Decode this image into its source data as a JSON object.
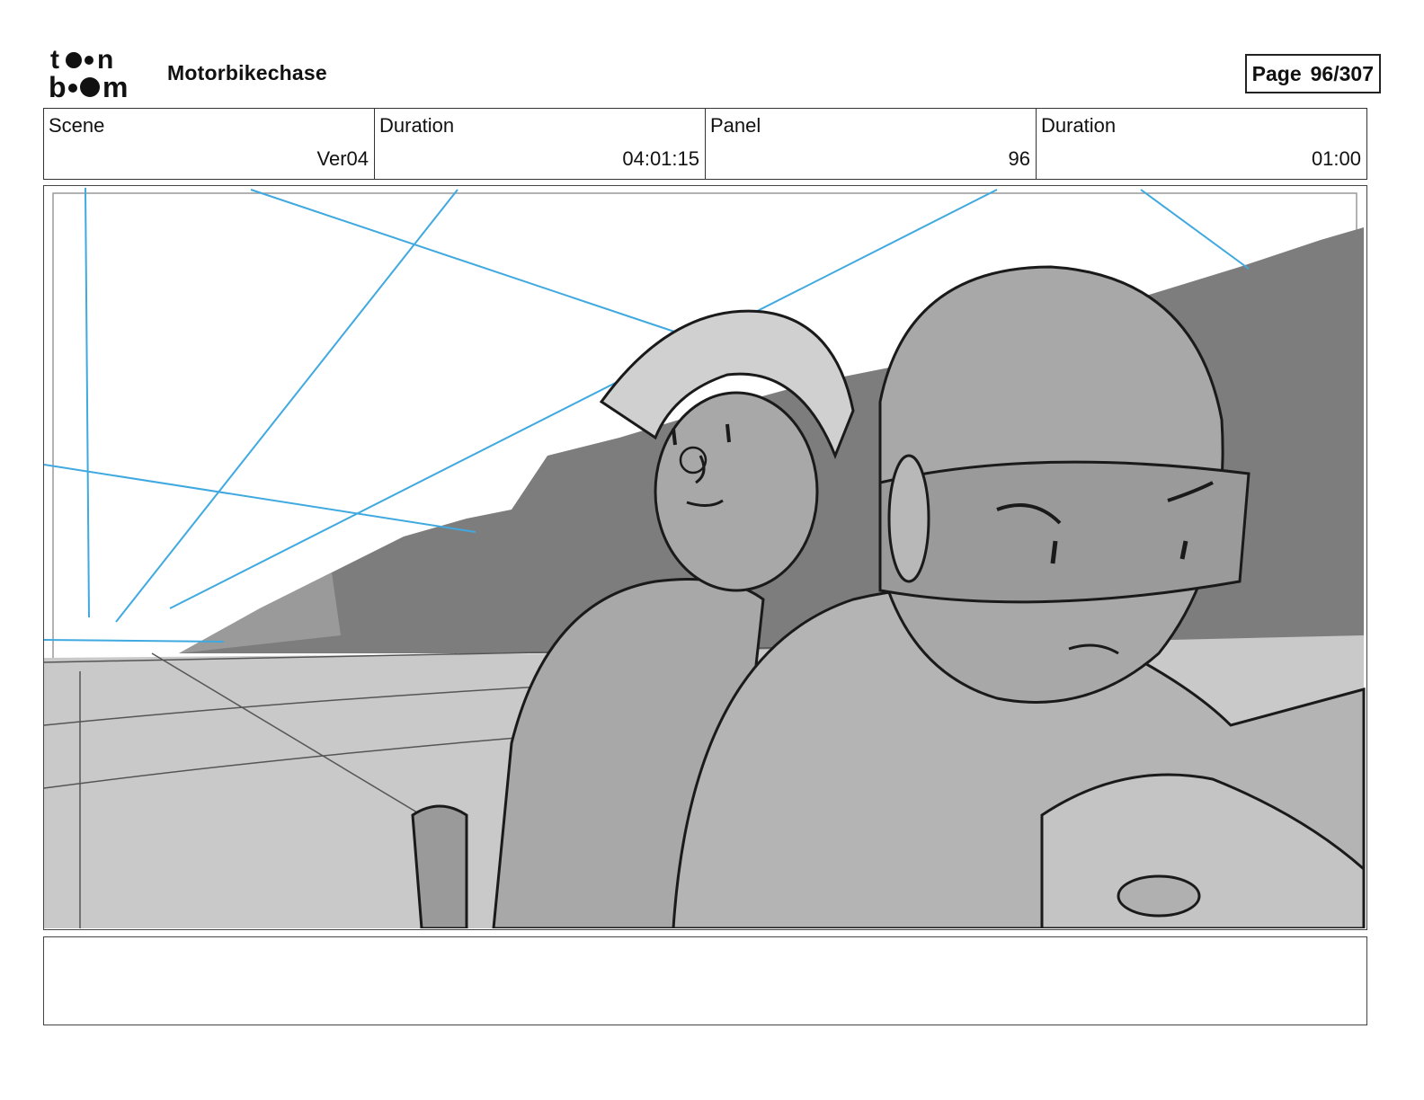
{
  "header": {
    "logo_text": "toon boom",
    "project_title": "Motorbikechase",
    "page_label": "Page",
    "page_value": "96/307"
  },
  "info": [
    {
      "label": "Scene",
      "value": "Ver04"
    },
    {
      "label": "Duration",
      "value": "04:01:15"
    },
    {
      "label": "Panel",
      "value": "96"
    },
    {
      "label": "Duration",
      "value": "01:00"
    }
  ],
  "panel": {
    "description": "",
    "colors": {
      "guide_lines": "#3fa9e0",
      "dark_tone": "#7d7d7d",
      "mid_tone": "#a8a8a8",
      "light_tone": "#c9c9c9",
      "ink": "#1a1a1a"
    }
  },
  "notes": {
    "text": ""
  }
}
